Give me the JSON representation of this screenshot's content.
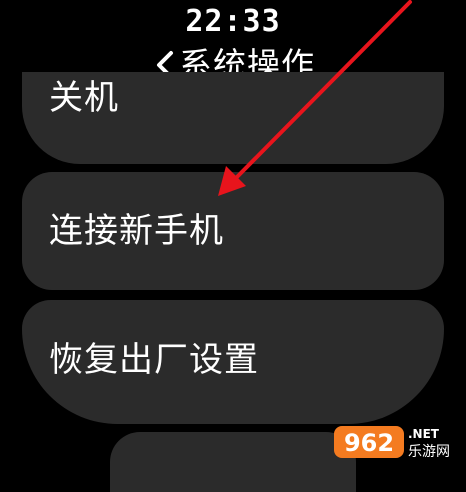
{
  "status": {
    "time": "22:33"
  },
  "header": {
    "back_icon": "chevron-left-icon",
    "title": "系统操作"
  },
  "menu": {
    "items": [
      {
        "label": "关机"
      },
      {
        "label": "连接新手机"
      },
      {
        "label": "恢复出厂设置"
      }
    ]
  },
  "annotation": {
    "arrow_color": "#e8141c"
  },
  "watermark": {
    "number": "962",
    "suffix": ".NET",
    "site": "乐游网"
  },
  "colors": {
    "background": "#000000",
    "card": "#2b2b2b",
    "text": "#ffffff"
  }
}
